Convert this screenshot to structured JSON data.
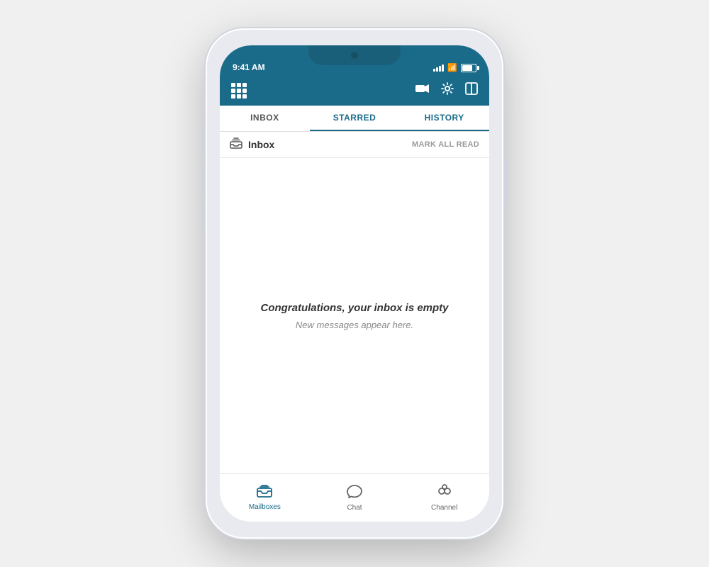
{
  "status_bar": {
    "time": "9:41 AM",
    "signal_label": "signal",
    "wifi_label": "wifi",
    "battery_label": "battery"
  },
  "header": {
    "grid_icon_label": "grid-menu",
    "video_icon_label": "video-camera",
    "settings_icon_label": "settings",
    "layout_icon_label": "layout"
  },
  "tabs": [
    {
      "id": "inbox",
      "label": "INBOX",
      "active": true
    },
    {
      "id": "starred",
      "label": "STARRED",
      "active": false
    },
    {
      "id": "history",
      "label": "HISTORY",
      "active": false
    }
  ],
  "inbox_header": {
    "icon_label": "inbox-icon",
    "title": "Inbox",
    "mark_all_read": "MARK ALL READ"
  },
  "empty_state": {
    "title": "Congratulations, your inbox is empty",
    "subtitle": "New messages appear here."
  },
  "bottom_nav": [
    {
      "id": "mailboxes",
      "label": "Mailboxes",
      "icon": "mailbox",
      "active": true
    },
    {
      "id": "chat",
      "label": "Chat",
      "icon": "chat",
      "active": false
    },
    {
      "id": "channel",
      "label": "Channel",
      "icon": "channel",
      "active": false
    }
  ]
}
